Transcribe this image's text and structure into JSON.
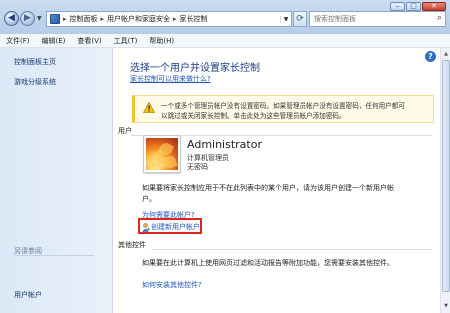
{
  "window": {
    "breadcrumbs": [
      "控制面板",
      "用户帐户和家庭安全",
      "家长控制"
    ],
    "search_placeholder": "搜索控制面板",
    "controls": {
      "minimize": "–",
      "maximize": "□",
      "close": "✕"
    }
  },
  "menu": {
    "items": [
      "文件(F)",
      "编辑(E)",
      "查看(V)",
      "工具(T)",
      "帮助(H)"
    ]
  },
  "left_pane": {
    "links": [
      "控制面板主页",
      "游戏分级系统"
    ],
    "see_also_label": "另请参阅",
    "see_also_links": [
      "用户帐户"
    ]
  },
  "content": {
    "title": "选择一个用户并设置家长控制",
    "subtitle_link": "家长控制可以用来做什么?",
    "warning": {
      "line1": "一个或多个管理员帐户没有设置密码。如果管理员帐户没有设置密码，任何用户都可",
      "line2": "以跳过或关闭家长控制。单击此处为这些管理员帐户添加密码。"
    },
    "users_section_label": "用户",
    "user": {
      "name": "Administrator",
      "role": "计算机管理员",
      "password_status": "无密码"
    },
    "info_text": "如果要将家长控制应用于不在此列表中的某个用户，请为该用户创建一个新用户帐户。",
    "why_link": "为何需要此帐户?",
    "create_link": "创建新用户帐户",
    "other_section_label": "其他控件",
    "other_text": "如果要在此计算机上使用网页过滤和活动报告等附加功能，您需要安装其他控件。",
    "install_link": "如何安装其他控件?"
  },
  "colors": {
    "link": "#1e56b8",
    "title": "#1f3f84",
    "highlight_box": "#e0261c",
    "warning_bar": "#f2c531"
  }
}
